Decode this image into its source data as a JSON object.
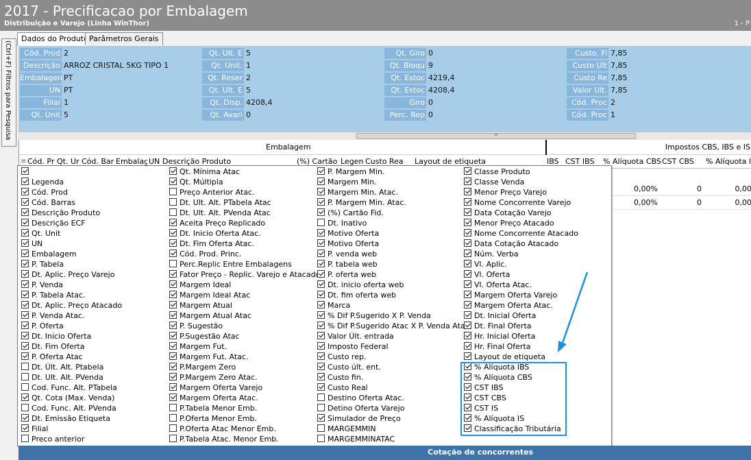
{
  "window": {
    "title": "2017 - Precificacao por Embalagem",
    "subtitle": "Distribuição e Varejo (Linha WinThor)",
    "version": "1 - P"
  },
  "side_tab": {
    "label": "(Ctrl+F) Filtros para Pesquisa"
  },
  "tabs": [
    {
      "label": "Dados do Produto",
      "active": true
    },
    {
      "label": "Parâmetros Gerais",
      "active": false
    }
  ],
  "info_panel": {
    "col1": [
      {
        "label": "Cód. Prod",
        "value": "2"
      },
      {
        "label": "Descrição",
        "value": "ARROZ CRISTAL 5KG TIPO 1"
      },
      {
        "label": "Embalagem",
        "value": "PT"
      },
      {
        "label": "UN",
        "value": "PT"
      },
      {
        "label": "Filial",
        "value": "1"
      },
      {
        "label": "Qt. Unit",
        "value": "5"
      }
    ],
    "col2": [
      {
        "label": "Qt. Ult. E",
        "value": "5"
      },
      {
        "label": "Qt. Unit.",
        "value": "1"
      },
      {
        "label": "Qt. Reser",
        "value": "2"
      },
      {
        "label": "Qt. Ult. E",
        "value": "5"
      },
      {
        "label": "Qt. Disp.",
        "value": "4208,4"
      },
      {
        "label": "Qt. Avari",
        "value": "0"
      }
    ],
    "col3": [
      {
        "label": "Qt. Giro",
        "value": "0"
      },
      {
        "label": "Qt. Bloqu",
        "value": "9"
      },
      {
        "label": "Qt. Estoc",
        "value": "4219,4"
      },
      {
        "label": "Qt. Estoc",
        "value": "4208,4"
      },
      {
        "label": "Giro",
        "value": "0"
      },
      {
        "label": "Perc. Rep",
        "value": "0"
      }
    ],
    "col4": [
      {
        "label": "Custo. Fi",
        "value": "7,85"
      },
      {
        "label": "Custo Ult",
        "value": "7,85"
      },
      {
        "label": "Custo Re",
        "value": "7,85"
      },
      {
        "label": "Valor Ult.",
        "value": "7,85"
      },
      {
        "label": "Cód. Proc",
        "value": "2"
      },
      {
        "label": "Cód. Proc",
        "value": "1"
      }
    ]
  },
  "splitter": {
    "glyph": "^"
  },
  "grid": {
    "group_left": "Embalagem",
    "group_right": "Impostos CBS, IBS e IS",
    "menu_glyph": "≡",
    "columns": [
      "Cód. Pr",
      "Qt. Ur",
      "Cód. Barr",
      "Embalage",
      "UN",
      "Descrição Produto",
      "(%) Cartão I",
      "Legend",
      "Custo Rea",
      "Layout de etiqueta",
      "IBS",
      "CST IBS",
      "% Alíquota CBS",
      "CST CBS",
      "% Alíquota IS"
    ],
    "rows": [
      {
        "aliq_cbs": "0,00%",
        "cst_cbs": "0",
        "aliq_is": "0,00"
      },
      {
        "aliq_cbs": "0,00%",
        "cst_cbs": "0",
        "aliq_is": "0,00"
      }
    ]
  },
  "column_chooser": {
    "columns": [
      [
        {
          "label": "",
          "checked": true
        },
        {
          "label": "Legenda",
          "checked": true
        },
        {
          "label": "Cód. Prod",
          "checked": true
        },
        {
          "label": "Cód. Barras",
          "checked": true
        },
        {
          "label": "Descrição Produto",
          "checked": true
        },
        {
          "label": "Descrição ECF",
          "checked": true
        },
        {
          "label": "Qt. Unit",
          "checked": true
        },
        {
          "label": "UN",
          "checked": true
        },
        {
          "label": "Embalagem",
          "checked": true
        },
        {
          "label": "P. Tabela",
          "checked": true
        },
        {
          "label": "Dt. Aplic. Preço Varejo",
          "checked": true
        },
        {
          "label": "P. Venda",
          "checked": true
        },
        {
          "label": "P. Tabela Atac.",
          "checked": true
        },
        {
          "label": "Dt. Aplic. Preço Atacado",
          "checked": true
        },
        {
          "label": "P. Venda Atac.",
          "checked": true
        },
        {
          "label": "P. Oferta",
          "checked": true
        },
        {
          "label": "Dt. Inicio Oferta",
          "checked": true
        },
        {
          "label": "Dt. Fim Oferta",
          "checked": true
        },
        {
          "label": "P. Oferta Atac",
          "checked": true
        },
        {
          "label": "Dt. Últ. Alt. Ptabela",
          "checked": false
        },
        {
          "label": "Dt. Ult. Alt. PVenda",
          "checked": false
        },
        {
          "label": "Cod. Func. Alt. PTabela",
          "checked": false
        },
        {
          "label": "Qt. Cota (Max. Venda)",
          "checked": true
        },
        {
          "label": "Cod. Func. Alt. PVenda",
          "checked": false
        },
        {
          "label": "Dt. Emissão Etiqueta",
          "checked": true
        },
        {
          "label": "Filial",
          "checked": true
        },
        {
          "label": "Preco anterior",
          "checked": false
        }
      ],
      [
        {
          "label": "Qt. Mínima Atac",
          "checked": true
        },
        {
          "label": "Qt. Múltipla",
          "checked": true
        },
        {
          "label": "Preço Anterior Atac.",
          "checked": false
        },
        {
          "label": "Dt. Ult. Alt. PTabela Atac",
          "checked": false
        },
        {
          "label": "Dt. Ult. Alt. PVenda Atac",
          "checked": false
        },
        {
          "label": "Aceita Preço Replicado",
          "checked": true
        },
        {
          "label": "Dt. Inicio Oferta Atac.",
          "checked": true
        },
        {
          "label": "Dt. Fim Oferta Atac.",
          "checked": true
        },
        {
          "label": "Cód. Prod. Princ.",
          "checked": true
        },
        {
          "label": "Perc.Replic Entre Embalagens",
          "checked": false
        },
        {
          "label": "Fator Preço - Replic. Varejo e Atacado",
          "checked": true
        },
        {
          "label": "Margem Ideal",
          "checked": true
        },
        {
          "label": "Margem Ideal Atac",
          "checked": true
        },
        {
          "label": "Margem Atual",
          "checked": true
        },
        {
          "label": "Margem Atual Atac",
          "checked": true
        },
        {
          "label": "P. Sugestão",
          "checked": true
        },
        {
          "label": "P.Sugestão Atac",
          "checked": true
        },
        {
          "label": "Margem Fut.",
          "checked": true
        },
        {
          "label": "Margem Fut. Atac.",
          "checked": true
        },
        {
          "label": "P.Margem Zero",
          "checked": true
        },
        {
          "label": "P.Margem Zero Atac.",
          "checked": true
        },
        {
          "label": "Margem Oferta Varejo",
          "checked": true
        },
        {
          "label": "Margem Oferta Atac.",
          "checked": true
        },
        {
          "label": "P.Tabela Menor Emb.",
          "checked": false
        },
        {
          "label": "P.Oferta Menor Emb.",
          "checked": false
        },
        {
          "label": "P.Oferta Atac Menor Emb.",
          "checked": false
        },
        {
          "label": "P.Tabela Atac. Menor Emb.",
          "checked": false
        }
      ],
      [
        {
          "label": "P. Margem Min.",
          "checked": true
        },
        {
          "label": "Margem Min.",
          "checked": true
        },
        {
          "label": "Margem Min. Atac.",
          "checked": true
        },
        {
          "label": "P. Margem Min. Atac.",
          "checked": true
        },
        {
          "label": "(%) Cartão Fid.",
          "checked": true
        },
        {
          "label": "Dt. Inativo",
          "checked": false
        },
        {
          "label": "Motivo Oferta",
          "checked": true
        },
        {
          "label": "Motivo Oferta",
          "checked": true
        },
        {
          "label": "P. venda web",
          "checked": true
        },
        {
          "label": "P. tabela web",
          "checked": true
        },
        {
          "label": "P. oferta web",
          "checked": true
        },
        {
          "label": "Dt. inicio oferta web",
          "checked": true
        },
        {
          "label": "Dt. fim oferta web",
          "checked": true
        },
        {
          "label": "Marca",
          "checked": true
        },
        {
          "label": "% Dif P.Sugerido X P. Venda",
          "checked": true
        },
        {
          "label": "% Dif P.Sugerido Atac X P. Venda Atac",
          "checked": true
        },
        {
          "label": "Valor Últ. entrada",
          "checked": true
        },
        {
          "label": "Imposto Federal",
          "checked": true
        },
        {
          "label": "Custo rep.",
          "checked": true
        },
        {
          "label": "Custo últ. ent.",
          "checked": true
        },
        {
          "label": "Custo fin.",
          "checked": true
        },
        {
          "label": "Custo Real",
          "checked": true
        },
        {
          "label": "Destino Oferta Atac.",
          "checked": false
        },
        {
          "label": "Detino Oferta Varejo",
          "checked": false
        },
        {
          "label": "Simulador de Preço",
          "checked": true
        },
        {
          "label": "MARGEMMIN",
          "checked": false
        },
        {
          "label": "MARGEMMINATAC",
          "checked": false
        }
      ],
      [
        {
          "label": "Classe Produto",
          "checked": true
        },
        {
          "label": "Classe Venda",
          "checked": true
        },
        {
          "label": "Menor Preço Varejo",
          "checked": true
        },
        {
          "label": "Nome Concorrente Varejo",
          "checked": true
        },
        {
          "label": "Data Cotação Varejo",
          "checked": true
        },
        {
          "label": "Menor Preço Atacado",
          "checked": true
        },
        {
          "label": "Nome Concorrente Atacado",
          "checked": true
        },
        {
          "label": "Data Cotação Atacado",
          "checked": true
        },
        {
          "label": "Núm. Verba",
          "checked": true
        },
        {
          "label": "Vl. Aplic.",
          "checked": true
        },
        {
          "label": "Vl. Oferta",
          "checked": true
        },
        {
          "label": "Vl. Oferta Atac.",
          "checked": true
        },
        {
          "label": "Margem Oferta Varejo",
          "checked": true
        },
        {
          "label": "Margem Oferta Atac.",
          "checked": true
        },
        {
          "label": "Dt. Inicial Oferta",
          "checked": true
        },
        {
          "label": "Dt. Final Oferta",
          "checked": true
        },
        {
          "label": "Hr. Inicial Oferta",
          "checked": true
        },
        {
          "label": "Hr. Final Oferta",
          "checked": true
        },
        {
          "label": "Layout de etiqueta",
          "checked": true
        },
        {
          "label": "% Alíquota IBS",
          "checked": true
        },
        {
          "label": "% Alíquota CBS",
          "checked": true
        },
        {
          "label": "CST IBS",
          "checked": true
        },
        {
          "label": "CST CBS",
          "checked": true
        },
        {
          "label": "CST IS",
          "checked": true
        },
        {
          "label": "% Alíquota IS",
          "checked": true
        },
        {
          "label": "Classificação Tributária",
          "checked": true
        }
      ]
    ]
  },
  "bottom_bar": {
    "label": "Cotação de concorrentes"
  },
  "colors": {
    "highlight": "#1a8fe0",
    "panel": "#a8cde8",
    "label_bg": "#88b6dd",
    "bottom_bar": "#3f73a8"
  }
}
